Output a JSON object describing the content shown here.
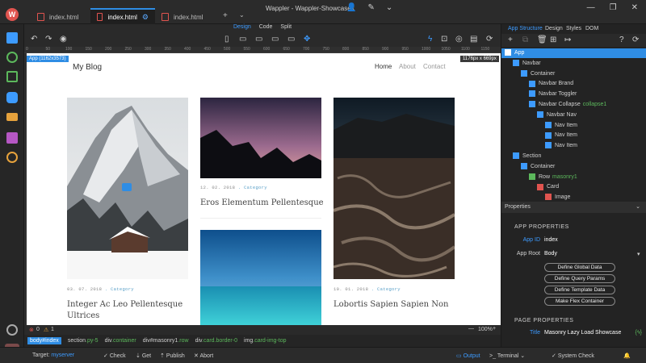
{
  "window": {
    "title": "Wappler - Wappler-Showcases"
  },
  "tabs": [
    {
      "label": "index.html",
      "active": false
    },
    {
      "label": "index.html",
      "active": true
    },
    {
      "label": "index.html",
      "active": false
    }
  ],
  "modes": {
    "design": "Design",
    "code": "Code",
    "split": "Split"
  },
  "canvas": {
    "app_badge": "App (1162x3573)",
    "size_badge": "1176px x 669px",
    "brand": "My Blog",
    "nav": [
      "Home",
      "About",
      "Contact"
    ],
    "cards": [
      {
        "date": "03. 07. 2018",
        "sep": ".",
        "category": "Category",
        "title": "Integer Ac Leo Pellentesque Ultrices"
      },
      {
        "date": "12. 02. 2018",
        "sep": ".",
        "category": "Category",
        "title": "Eros Elementum Pellentesque"
      },
      {
        "date": "10. 01. 2018",
        "sep": ".",
        "category": "Category",
        "title": "Lobortis Sapien Sapien Non"
      }
    ]
  },
  "status": {
    "errors": "0",
    "warnings": "1",
    "zoom": "100%"
  },
  "breadcrumb": [
    {
      "label": "body#index",
      "selected": true
    },
    {
      "tag": "section",
      "cls": ".py-5"
    },
    {
      "tag": "div",
      "cls": ".container"
    },
    {
      "tag": "div#masonry1",
      "cls": ".row"
    },
    {
      "tag": "div",
      "cls": ".card.border-0"
    },
    {
      "tag": "img",
      "cls": ".card-img-top"
    }
  ],
  "bottom": {
    "target_label": "Target:",
    "target_value": "myserver",
    "check": "Check",
    "get": "Get",
    "publish": "Publish",
    "abort": "Abort",
    "output": "Output",
    "terminal": "Terminal",
    "system_check": "System Check"
  },
  "right_tabs": {
    "structure": "App Structure",
    "design": "Design",
    "styles": "Styles",
    "dom": "DOM"
  },
  "tree": [
    {
      "label": "App",
      "cls": "",
      "selected": true
    },
    {
      "label": "Navbar",
      "cls": ""
    },
    {
      "label": "Container",
      "cls": ""
    },
    {
      "label": "Navbar Brand",
      "cls": ""
    },
    {
      "label": "Navbar Toggler",
      "cls": ""
    },
    {
      "label": "Navbar Collapse",
      "cls": "collapse1"
    },
    {
      "label": "Navbar Nav",
      "cls": ""
    },
    {
      "label": "Nav Item",
      "cls": ""
    },
    {
      "label": "Nav Item",
      "cls": ""
    },
    {
      "label": "Nav Item",
      "cls": ""
    },
    {
      "label": "Section",
      "cls": ""
    },
    {
      "label": "Container",
      "cls": ""
    },
    {
      "label": "Row",
      "cls": "masonry1"
    },
    {
      "label": "Card",
      "cls": ""
    },
    {
      "label": "Image",
      "cls": ""
    }
  ],
  "properties": {
    "header": "Properties",
    "app_section": "APP PROPERTIES",
    "app_id_label": "App ID",
    "app_id_value": "index",
    "app_root_label": "App Root",
    "app_root_value": "Body",
    "buttons": [
      "Define Global Data",
      "Define Query Params",
      "Define Template Data",
      "Make Flex Container"
    ],
    "page_section": "PAGE PROPERTIES",
    "title_label": "Title",
    "title_value": "Masonry Lazy Load Showcase"
  },
  "ruler_ticks": [
    "0",
    "50",
    "100",
    "150",
    "200",
    "250",
    "300",
    "350",
    "400",
    "450",
    "500",
    "550",
    "600",
    "650",
    "700",
    "750",
    "800",
    "850",
    "900",
    "950",
    "1000",
    "1050",
    "1100",
    "1150"
  ],
  "colors": {
    "accent": "#2f8de4",
    "brand_red": "#e0544f",
    "green": "#5cb85c"
  }
}
